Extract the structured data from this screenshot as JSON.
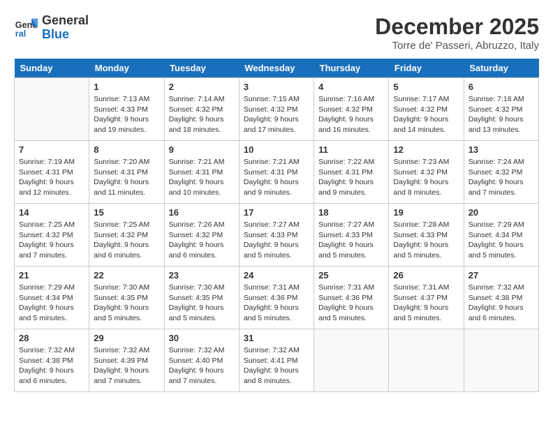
{
  "logo": {
    "line1": "General",
    "line2": "Blue"
  },
  "header": {
    "month": "December 2025",
    "location": "Torre de' Passeri, Abruzzo, Italy"
  },
  "weekdays": [
    "Sunday",
    "Monday",
    "Tuesday",
    "Wednesday",
    "Thursday",
    "Friday",
    "Saturday"
  ],
  "weeks": [
    [
      {
        "day": "",
        "info": ""
      },
      {
        "day": "1",
        "info": "Sunrise: 7:13 AM\nSunset: 4:33 PM\nDaylight: 9 hours\nand 19 minutes."
      },
      {
        "day": "2",
        "info": "Sunrise: 7:14 AM\nSunset: 4:32 PM\nDaylight: 9 hours\nand 18 minutes."
      },
      {
        "day": "3",
        "info": "Sunrise: 7:15 AM\nSunset: 4:32 PM\nDaylight: 9 hours\nand 17 minutes."
      },
      {
        "day": "4",
        "info": "Sunrise: 7:16 AM\nSunset: 4:32 PM\nDaylight: 9 hours\nand 16 minutes."
      },
      {
        "day": "5",
        "info": "Sunrise: 7:17 AM\nSunset: 4:32 PM\nDaylight: 9 hours\nand 14 minutes."
      },
      {
        "day": "6",
        "info": "Sunrise: 7:18 AM\nSunset: 4:32 PM\nDaylight: 9 hours\nand 13 minutes."
      }
    ],
    [
      {
        "day": "7",
        "info": "Sunrise: 7:19 AM\nSunset: 4:31 PM\nDaylight: 9 hours\nand 12 minutes."
      },
      {
        "day": "8",
        "info": "Sunrise: 7:20 AM\nSunset: 4:31 PM\nDaylight: 9 hours\nand 11 minutes."
      },
      {
        "day": "9",
        "info": "Sunrise: 7:21 AM\nSunset: 4:31 PM\nDaylight: 9 hours\nand 10 minutes."
      },
      {
        "day": "10",
        "info": "Sunrise: 7:21 AM\nSunset: 4:31 PM\nDaylight: 9 hours\nand 9 minutes."
      },
      {
        "day": "11",
        "info": "Sunrise: 7:22 AM\nSunset: 4:31 PM\nDaylight: 9 hours\nand 9 minutes."
      },
      {
        "day": "12",
        "info": "Sunrise: 7:23 AM\nSunset: 4:32 PM\nDaylight: 9 hours\nand 8 minutes."
      },
      {
        "day": "13",
        "info": "Sunrise: 7:24 AM\nSunset: 4:32 PM\nDaylight: 9 hours\nand 7 minutes."
      }
    ],
    [
      {
        "day": "14",
        "info": "Sunrise: 7:25 AM\nSunset: 4:32 PM\nDaylight: 9 hours\nand 7 minutes."
      },
      {
        "day": "15",
        "info": "Sunrise: 7:25 AM\nSunset: 4:32 PM\nDaylight: 9 hours\nand 6 minutes."
      },
      {
        "day": "16",
        "info": "Sunrise: 7:26 AM\nSunset: 4:32 PM\nDaylight: 9 hours\nand 6 minutes."
      },
      {
        "day": "17",
        "info": "Sunrise: 7:27 AM\nSunset: 4:33 PM\nDaylight: 9 hours\nand 5 minutes."
      },
      {
        "day": "18",
        "info": "Sunrise: 7:27 AM\nSunset: 4:33 PM\nDaylight: 9 hours\nand 5 minutes."
      },
      {
        "day": "19",
        "info": "Sunrise: 7:28 AM\nSunset: 4:33 PM\nDaylight: 9 hours\nand 5 minutes."
      },
      {
        "day": "20",
        "info": "Sunrise: 7:29 AM\nSunset: 4:34 PM\nDaylight: 9 hours\nand 5 minutes."
      }
    ],
    [
      {
        "day": "21",
        "info": "Sunrise: 7:29 AM\nSunset: 4:34 PM\nDaylight: 9 hours\nand 5 minutes."
      },
      {
        "day": "22",
        "info": "Sunrise: 7:30 AM\nSunset: 4:35 PM\nDaylight: 9 hours\nand 5 minutes."
      },
      {
        "day": "23",
        "info": "Sunrise: 7:30 AM\nSunset: 4:35 PM\nDaylight: 9 hours\nand 5 minutes."
      },
      {
        "day": "24",
        "info": "Sunrise: 7:31 AM\nSunset: 4:36 PM\nDaylight: 9 hours\nand 5 minutes."
      },
      {
        "day": "25",
        "info": "Sunrise: 7:31 AM\nSunset: 4:36 PM\nDaylight: 9 hours\nand 5 minutes."
      },
      {
        "day": "26",
        "info": "Sunrise: 7:31 AM\nSunset: 4:37 PM\nDaylight: 9 hours\nand 5 minutes."
      },
      {
        "day": "27",
        "info": "Sunrise: 7:32 AM\nSunset: 4:38 PM\nDaylight: 9 hours\nand 6 minutes."
      }
    ],
    [
      {
        "day": "28",
        "info": "Sunrise: 7:32 AM\nSunset: 4:38 PM\nDaylight: 9 hours\nand 6 minutes."
      },
      {
        "day": "29",
        "info": "Sunrise: 7:32 AM\nSunset: 4:39 PM\nDaylight: 9 hours\nand 7 minutes."
      },
      {
        "day": "30",
        "info": "Sunrise: 7:32 AM\nSunset: 4:40 PM\nDaylight: 9 hours\nand 7 minutes."
      },
      {
        "day": "31",
        "info": "Sunrise: 7:32 AM\nSunset: 4:41 PM\nDaylight: 9 hours\nand 8 minutes."
      },
      {
        "day": "",
        "info": ""
      },
      {
        "day": "",
        "info": ""
      },
      {
        "day": "",
        "info": ""
      }
    ]
  ]
}
